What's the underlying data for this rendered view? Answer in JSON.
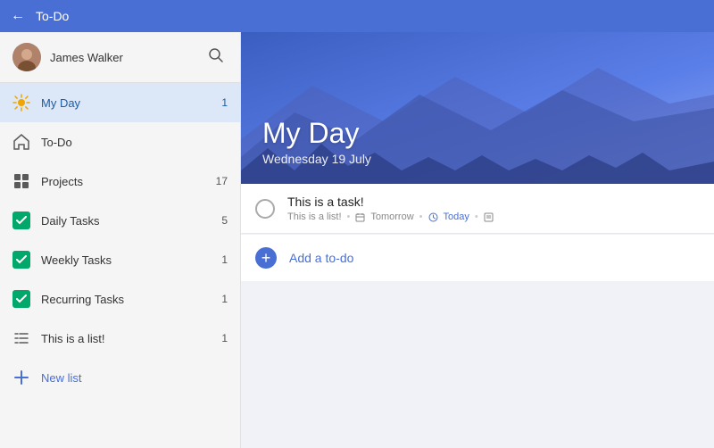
{
  "topbar": {
    "back_label": "←",
    "title": "To-Do"
  },
  "sidebar": {
    "user_name": "James Walker",
    "search_tooltip": "Search",
    "items": [
      {
        "id": "my-day",
        "label": "My Day",
        "icon": "sun",
        "badge": "1",
        "active": true
      },
      {
        "id": "todo",
        "label": "To-Do",
        "icon": "home",
        "badge": "",
        "active": false
      },
      {
        "id": "projects",
        "label": "Projects",
        "icon": "grid",
        "badge": "17",
        "active": false
      },
      {
        "id": "daily-tasks",
        "label": "Daily Tasks",
        "icon": "check-green",
        "badge": "5",
        "active": false
      },
      {
        "id": "weekly-tasks",
        "label": "Weekly Tasks",
        "icon": "check-green",
        "badge": "1",
        "active": false
      },
      {
        "id": "recurring-tasks",
        "label": "Recurring Tasks",
        "icon": "check-green",
        "badge": "1",
        "active": false
      },
      {
        "id": "this-is-a-list",
        "label": "This is a list!",
        "icon": "list-lines",
        "badge": "1",
        "active": false
      }
    ],
    "new_list_label": "New list"
  },
  "content": {
    "header": {
      "title": "My Day",
      "subtitle": "Wednesday 19 July"
    },
    "tasks": [
      {
        "id": "task-1",
        "title": "This is a task!",
        "list": "This is a list!",
        "due_label": "Tomorrow",
        "today_label": "Today",
        "has_note": true
      }
    ],
    "add_todo_label": "Add a to-do"
  }
}
